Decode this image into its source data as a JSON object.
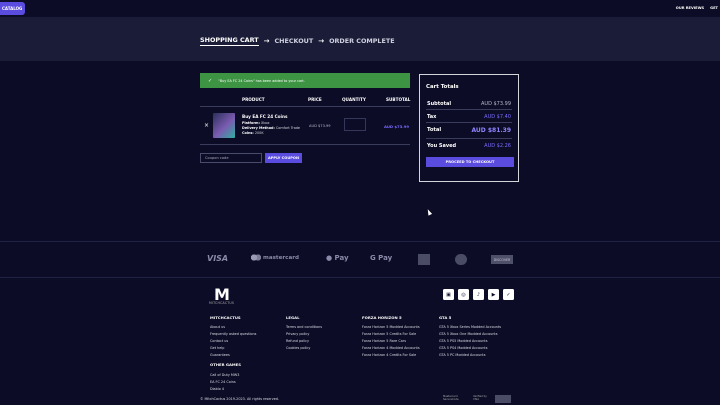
{
  "header": {
    "catalog": "CATALOG",
    "links": [
      "OUR REVIEWS",
      "GET"
    ]
  },
  "steps": {
    "cart": "SHOPPING CART",
    "checkout": "CHECKOUT",
    "complete": "ORDER COMPLETE",
    "arrow": "→"
  },
  "notice": "\"Buy EA FC 24 Coins\" has been added to your cart.",
  "cart": {
    "columns": [
      "PRODUCT",
      "PRICE",
      "QUANTITY",
      "SUBTOTAL"
    ],
    "item": {
      "name": "Buy EA FC 24 Coins",
      "platform_label": "Platform:",
      "platform": "Xbox",
      "delivery_label": "Delivery Method:",
      "delivery": "Comfort Trade",
      "coins_label": "Coins:",
      "coins": "200K",
      "price": "AUD $73.99",
      "subtotal": "AUD $73.99",
      "remove": "×"
    },
    "coupon_placeholder": "Coupon code",
    "apply_label": "APPLY COUPON"
  },
  "totals": {
    "title": "Cart Totals",
    "subtotal_label": "Subtotal",
    "subtotal": "AUD $73.99",
    "tax_label": "Tax",
    "tax": "AUD $7.40",
    "total_label": "Total",
    "total": "AUD $81.39",
    "saved_label": "You Saved",
    "saved": "AUD $2.26",
    "checkout_label": "PROCEED TO CHECKOUT"
  },
  "payments": {
    "visa": "VISA",
    "mastercard": "mastercard",
    "applepay": " Pay",
    "gpay": "G Pay",
    "discover": "DISCOVER"
  },
  "footer": {
    "logo_letter": "M",
    "logo_text": "MITCHCACTUS",
    "social": [
      "▣",
      "◎",
      "♪",
      "▶",
      "✓"
    ],
    "col1": {
      "title": "MITCHCACTUS",
      "links": [
        "About us",
        "Frequently asked questions",
        "Contact us",
        "Get help",
        "Guarantees"
      ]
    },
    "col1b": {
      "title": "OTHER GAMES",
      "links": [
        "Call of Duty MW3",
        "EA FC 24 Coins",
        "Diablo 4"
      ]
    },
    "col2": {
      "title": "LEGAL",
      "links": [
        "Terms and conditions",
        "Privacy policy",
        "Refund policy",
        "Cookies policy"
      ]
    },
    "col3": {
      "title": "FORZA HORIZON 5",
      "links": [
        "Forza Horizon 5 Modded Accounts",
        "Forza Horizon 5 Credits For Sale",
        "Forza Horizon 5 Rare Cars",
        "Forza Horizon 4 Modded Accounts",
        "Forza Horizon 4 Credits For Sale"
      ]
    },
    "col4": {
      "title": "GTA 5",
      "links": [
        "GTA 5 Xbox Series Modded Accounts",
        "GTA 5 Xbox One Modded Accounts",
        "GTA 5 PS5 Modded Accounts",
        "GTA 5 PS4 Modded Accounts",
        "GTA 5 PC Modded Accounts"
      ]
    },
    "copyright": "© MitchCactus 2019-2023. All rights reserved.",
    "badge1": "Mastercard SecureCode",
    "badge2": "Verified by VISA"
  }
}
